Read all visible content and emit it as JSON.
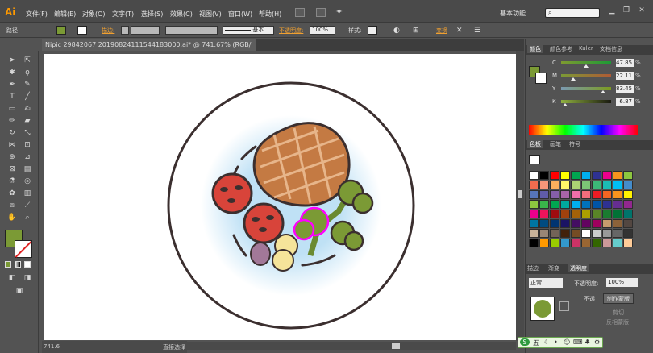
{
  "app": {
    "logo": "Ai"
  },
  "menu": [
    "文件(F)",
    "编辑(E)",
    "对象(O)",
    "文字(T)",
    "选择(S)",
    "效果(C)",
    "视图(V)",
    "窗口(W)",
    "帮助(H)"
  ],
  "workspace": {
    "label": "基本功能",
    "search_placeholder": ""
  },
  "control": {
    "path_label": "路径",
    "stroke_label": "描边:",
    "profile_label": "基本",
    "opacity_label": "不透明度:",
    "opacity_value": "100%",
    "style_label": "样式:",
    "transform_label": "变换"
  },
  "document": {
    "tab_title": "Nipic 29842067 20190824111544183000.ai* @ 741.67% (RGB/预览)",
    "close": "×"
  },
  "status": {
    "zoom": "741.6",
    "tool": "直接选择"
  },
  "color_panel": {
    "tabs": [
      "颜色",
      "颜色参考",
      "Kuler",
      "文档信息"
    ],
    "channels": [
      {
        "name": "C",
        "value": "47.85",
        "unit": "%",
        "pos": 0.48
      },
      {
        "name": "M",
        "value": "22.11",
        "unit": "%",
        "pos": 0.22
      },
      {
        "name": "Y",
        "value": "83.45",
        "unit": "%",
        "pos": 0.83
      },
      {
        "name": "K",
        "value": "6.87",
        "unit": "%",
        "pos": 0.07
      }
    ],
    "fill_color": "#7b9a35"
  },
  "swatches_panel": {
    "tabs": [
      "色板",
      "画笔",
      "符号"
    ],
    "colors": [
      "#ffffff",
      "#000000",
      "#ff0000",
      "#ffff00",
      "#00a550",
      "#00aeef",
      "#2e3192",
      "#ec008c",
      "#f7941d",
      "#8dc63f",
      "#f26c4f",
      "#f69679",
      "#fbaf5d",
      "#fff568",
      "#acd373",
      "#7cc576",
      "#3cb878",
      "#1cbbb4",
      "#00bff3",
      "#448ccb",
      "#5674b9",
      "#605ca8",
      "#855fa8",
      "#a864a8",
      "#f06eaa",
      "#f26d7d",
      "#ed1c24",
      "#f26522",
      "#f7941d",
      "#fff200",
      "#8dc63f",
      "#39b54a",
      "#00a651",
      "#00a99d",
      "#00aeef",
      "#0072bc",
      "#0054a6",
      "#2e3192",
      "#662d91",
      "#92278f",
      "#ec008c",
      "#ed145b",
      "#9e0b0f",
      "#a0410d",
      "#a36209",
      "#aba000",
      "#598527",
      "#1a7b30",
      "#007236",
      "#00746b",
      "#0076a3",
      "#004b80",
      "#003471",
      "#1b1464",
      "#440e62",
      "#630460",
      "#9e005d",
      "#c69c6d",
      "#8c6239",
      "#534741",
      "#c7b299",
      "#998675",
      "#736357",
      "#42210b",
      "#754c24",
      "#ffffff",
      "#cccccc",
      "#999999",
      "#666666",
      "#333333",
      "#000000",
      "#ff9900",
      "#99cc00",
      "#3399cc",
      "#cc3366",
      "#996633",
      "#336600",
      "#cc9999",
      "#66cccc",
      "#ffcc99"
    ]
  },
  "transparency_panel": {
    "tabs": [
      "描边",
      "渐变",
      "透明度"
    ],
    "mode": "正常",
    "opacity_label": "不透明度:",
    "opacity_value": "100%",
    "make_mask": "制作蒙版",
    "clip": "剪切",
    "invert": "反相蒙版",
    "no_mask": "不透"
  },
  "ime": {
    "label": "五"
  }
}
